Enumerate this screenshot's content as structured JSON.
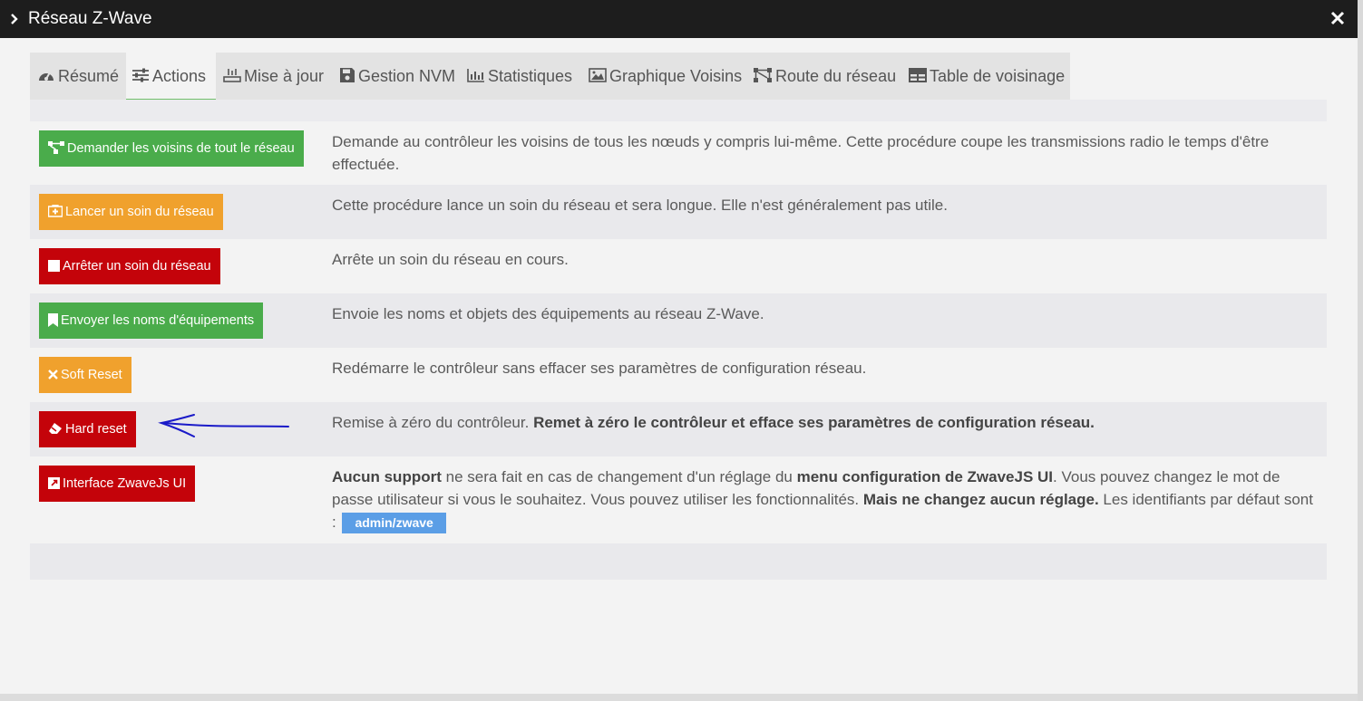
{
  "window": {
    "title": "Réseau Z-Wave"
  },
  "tabs": [
    {
      "label": "Résumé",
      "icon": "dashboard-icon"
    },
    {
      "label": "Actions",
      "icon": "sliders-icon",
      "active": true
    },
    {
      "label": "Mise à jour",
      "icon": "router-icon"
    },
    {
      "label": "Gestion NVM",
      "icon": "floppy-icon"
    },
    {
      "label": "Statistiques",
      "icon": "bar-chart-icon"
    },
    {
      "label": "Graphique Voisins",
      "icon": "image-icon"
    },
    {
      "label": "Route du réseau",
      "icon": "network-nodes-icon"
    },
    {
      "label": "Table de voisinage",
      "icon": "table-icon"
    }
  ],
  "actions": [
    {
      "label": "Demander les voisins de tout le réseau",
      "color": "#4aac4b",
      "description": "Demande au contrôleur les voisins de tous les nœuds y compris lui-même. Cette procédure coupe les transmissions radio le temps d'être effectuée."
    },
    {
      "label": "Lancer un soin du réseau",
      "color": "#f0a12d",
      "description": "Cette procédure lance un soin du réseau et sera longue. Elle n'est généralement pas utile."
    },
    {
      "label": "Arrêter un soin du réseau",
      "color": "#c4030a",
      "description": "Arrête un soin du réseau en cours."
    },
    {
      "label": "Envoyer les noms d'équipements",
      "color": "#4aac4b",
      "description": "Envoie les noms et objets des équipements au réseau Z-Wave."
    },
    {
      "label": "Soft Reset",
      "color": "#f0a12d",
      "description": "Redémarre le contrôleur sans effacer ses paramètres de configuration réseau."
    },
    {
      "label": "Hard reset",
      "color": "#c4030a",
      "description_plain": "Remise à zéro du contrôleur. ",
      "description_bold": "Remet à zéro le contrôleur et efface ses paramètres de configuration réseau."
    },
    {
      "label": "Interface ZwaveJs UI",
      "color": "#c4030a",
      "description_parts": [
        "Aucun support",
        " ne sera fait en cas de changement d'un réglage du ",
        "menu configuration de ZwaveJS UI",
        ". Vous pouvez changez le mot de passe utilisateur si vous le souhaitez. Vous pouvez utiliser les fonctionnalités. ",
        "Mais ne changez aucun réglage.",
        " Les identifiants par défaut sont : "
      ],
      "credentials": "admin/zwave"
    }
  ],
  "annotation": {
    "color": "#1a1ac8"
  }
}
